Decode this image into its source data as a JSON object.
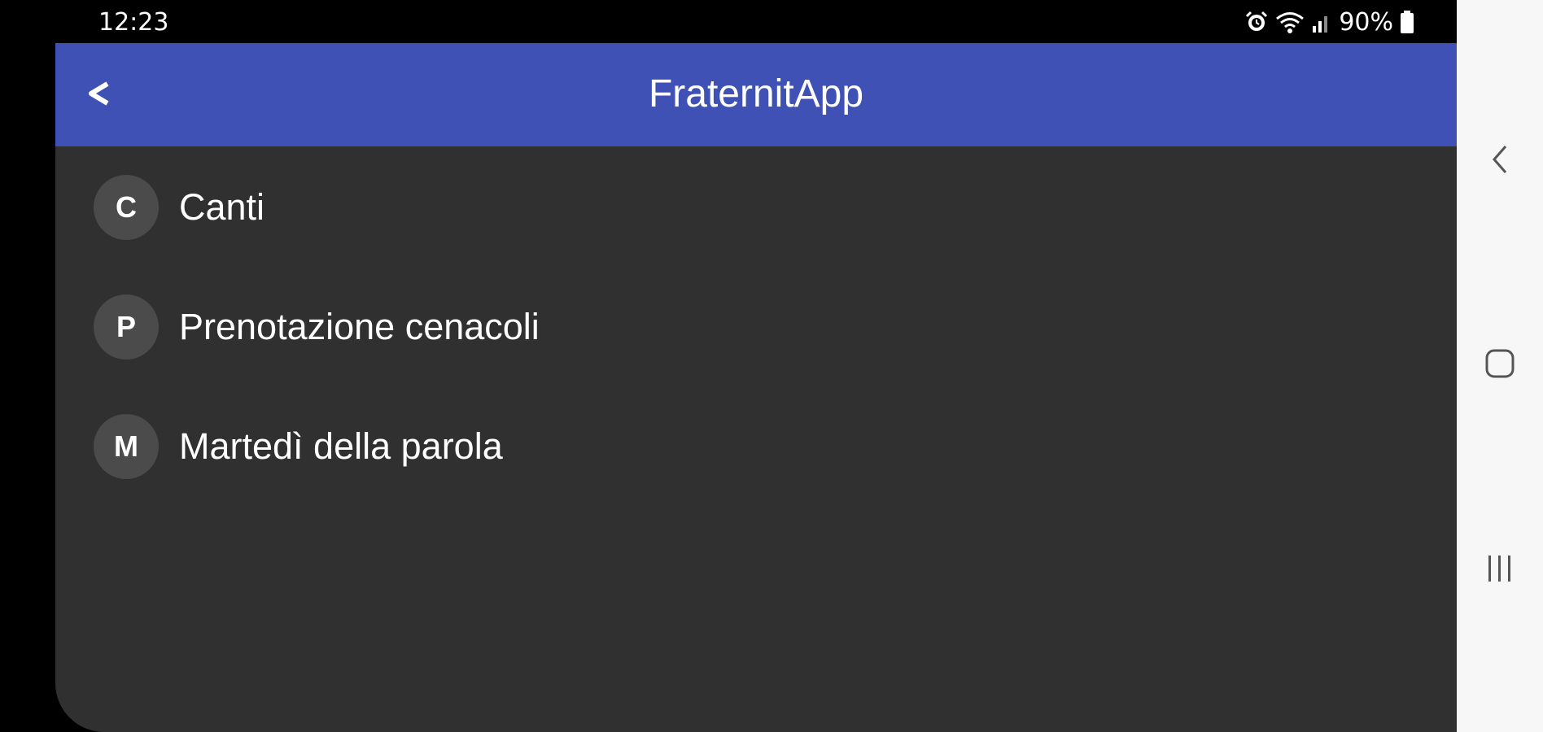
{
  "status_bar": {
    "time": "12:23",
    "battery": "90%",
    "icons": [
      "alarm-icon",
      "wifi-icon",
      "signal-icon",
      "battery-icon"
    ]
  },
  "app_bar": {
    "title": "FraternitApp",
    "back_label": "<",
    "color": "#3f51b5"
  },
  "menu": {
    "items": [
      {
        "initial": "C",
        "label": "Canti"
      },
      {
        "initial": "P",
        "label": "Prenotazione cenacoli"
      },
      {
        "initial": "M",
        "label": "Martedì della parola"
      }
    ]
  },
  "nav_bar": {
    "buttons": [
      "back-icon",
      "home-icon",
      "recents-icon"
    ]
  },
  "colors": {
    "background": "#303030",
    "avatar": "#4b4b4b",
    "text": "#ffffff"
  }
}
